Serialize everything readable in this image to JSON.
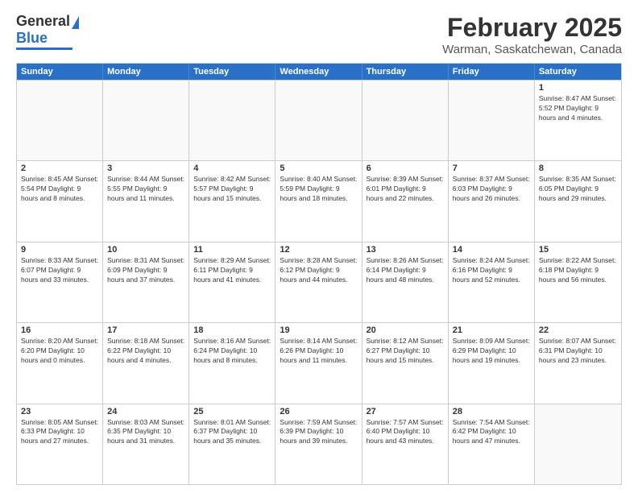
{
  "logo": {
    "general": "General",
    "blue": "Blue"
  },
  "header": {
    "title": "February 2025",
    "location": "Warman, Saskatchewan, Canada"
  },
  "weekdays": [
    "Sunday",
    "Monday",
    "Tuesday",
    "Wednesday",
    "Thursday",
    "Friday",
    "Saturday"
  ],
  "weeks": [
    [
      {
        "day": "",
        "info": ""
      },
      {
        "day": "",
        "info": ""
      },
      {
        "day": "",
        "info": ""
      },
      {
        "day": "",
        "info": ""
      },
      {
        "day": "",
        "info": ""
      },
      {
        "day": "",
        "info": ""
      },
      {
        "day": "1",
        "info": "Sunrise: 8:47 AM\nSunset: 5:52 PM\nDaylight: 9 hours and 4 minutes."
      }
    ],
    [
      {
        "day": "2",
        "info": "Sunrise: 8:45 AM\nSunset: 5:54 PM\nDaylight: 9 hours and 8 minutes."
      },
      {
        "day": "3",
        "info": "Sunrise: 8:44 AM\nSunset: 5:55 PM\nDaylight: 9 hours and 11 minutes."
      },
      {
        "day": "4",
        "info": "Sunrise: 8:42 AM\nSunset: 5:57 PM\nDaylight: 9 hours and 15 minutes."
      },
      {
        "day": "5",
        "info": "Sunrise: 8:40 AM\nSunset: 5:59 PM\nDaylight: 9 hours and 18 minutes."
      },
      {
        "day": "6",
        "info": "Sunrise: 8:39 AM\nSunset: 6:01 PM\nDaylight: 9 hours and 22 minutes."
      },
      {
        "day": "7",
        "info": "Sunrise: 8:37 AM\nSunset: 6:03 PM\nDaylight: 9 hours and 26 minutes."
      },
      {
        "day": "8",
        "info": "Sunrise: 8:35 AM\nSunset: 6:05 PM\nDaylight: 9 hours and 29 minutes."
      }
    ],
    [
      {
        "day": "9",
        "info": "Sunrise: 8:33 AM\nSunset: 6:07 PM\nDaylight: 9 hours and 33 minutes."
      },
      {
        "day": "10",
        "info": "Sunrise: 8:31 AM\nSunset: 6:09 PM\nDaylight: 9 hours and 37 minutes."
      },
      {
        "day": "11",
        "info": "Sunrise: 8:29 AM\nSunset: 6:11 PM\nDaylight: 9 hours and 41 minutes."
      },
      {
        "day": "12",
        "info": "Sunrise: 8:28 AM\nSunset: 6:12 PM\nDaylight: 9 hours and 44 minutes."
      },
      {
        "day": "13",
        "info": "Sunrise: 8:26 AM\nSunset: 6:14 PM\nDaylight: 9 hours and 48 minutes."
      },
      {
        "day": "14",
        "info": "Sunrise: 8:24 AM\nSunset: 6:16 PM\nDaylight: 9 hours and 52 minutes."
      },
      {
        "day": "15",
        "info": "Sunrise: 8:22 AM\nSunset: 6:18 PM\nDaylight: 9 hours and 56 minutes."
      }
    ],
    [
      {
        "day": "16",
        "info": "Sunrise: 8:20 AM\nSunset: 6:20 PM\nDaylight: 10 hours and 0 minutes."
      },
      {
        "day": "17",
        "info": "Sunrise: 8:18 AM\nSunset: 6:22 PM\nDaylight: 10 hours and 4 minutes."
      },
      {
        "day": "18",
        "info": "Sunrise: 8:16 AM\nSunset: 6:24 PM\nDaylight: 10 hours and 8 minutes."
      },
      {
        "day": "19",
        "info": "Sunrise: 8:14 AM\nSunset: 6:26 PM\nDaylight: 10 hours and 11 minutes."
      },
      {
        "day": "20",
        "info": "Sunrise: 8:12 AM\nSunset: 6:27 PM\nDaylight: 10 hours and 15 minutes."
      },
      {
        "day": "21",
        "info": "Sunrise: 8:09 AM\nSunset: 6:29 PM\nDaylight: 10 hours and 19 minutes."
      },
      {
        "day": "22",
        "info": "Sunrise: 8:07 AM\nSunset: 6:31 PM\nDaylight: 10 hours and 23 minutes."
      }
    ],
    [
      {
        "day": "23",
        "info": "Sunrise: 8:05 AM\nSunset: 6:33 PM\nDaylight: 10 hours and 27 minutes."
      },
      {
        "day": "24",
        "info": "Sunrise: 8:03 AM\nSunset: 6:35 PM\nDaylight: 10 hours and 31 minutes."
      },
      {
        "day": "25",
        "info": "Sunrise: 8:01 AM\nSunset: 6:37 PM\nDaylight: 10 hours and 35 minutes."
      },
      {
        "day": "26",
        "info": "Sunrise: 7:59 AM\nSunset: 6:39 PM\nDaylight: 10 hours and 39 minutes."
      },
      {
        "day": "27",
        "info": "Sunrise: 7:57 AM\nSunset: 6:40 PM\nDaylight: 10 hours and 43 minutes."
      },
      {
        "day": "28",
        "info": "Sunrise: 7:54 AM\nSunset: 6:42 PM\nDaylight: 10 hours and 47 minutes."
      },
      {
        "day": "",
        "info": ""
      }
    ]
  ]
}
